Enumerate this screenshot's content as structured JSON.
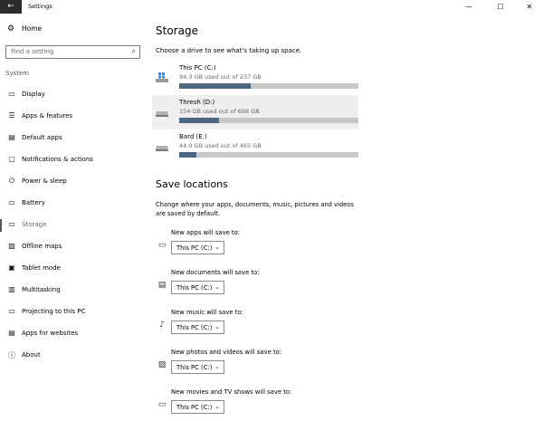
{
  "window": {
    "back_icon": "back-arrow-icon",
    "title": "Settings",
    "minimize": "—",
    "maximize": "☐",
    "close": "✕"
  },
  "sidebar": {
    "home": {
      "label": "Home",
      "icon": "gear-icon"
    },
    "search_placeholder": "Find a setting",
    "section": "System",
    "items": [
      {
        "label": "Display",
        "icon": "display-icon",
        "glyph": "▭"
      },
      {
        "label": "Apps & features",
        "icon": "apps-list-icon",
        "glyph": "☰"
      },
      {
        "label": "Default apps",
        "icon": "default-apps-icon",
        "glyph": "▤"
      },
      {
        "label": "Notifications & actions",
        "icon": "notifications-icon",
        "glyph": "▢"
      },
      {
        "label": "Power & sleep",
        "icon": "power-icon",
        "glyph": "⏻"
      },
      {
        "label": "Battery",
        "icon": "battery-icon",
        "glyph": "▭"
      },
      {
        "label": "Storage",
        "icon": "storage-icon",
        "glyph": "▭",
        "active": true
      },
      {
        "label": "Offline maps",
        "icon": "map-icon",
        "glyph": "▨"
      },
      {
        "label": "Tablet mode",
        "icon": "tablet-icon",
        "glyph": "▣"
      },
      {
        "label": "Multitasking",
        "icon": "multitasking-icon",
        "glyph": "▥"
      },
      {
        "label": "Projecting to this PC",
        "icon": "projecting-icon",
        "glyph": "▭"
      },
      {
        "label": "Apps for websites",
        "icon": "apps-websites-icon",
        "glyph": "▤"
      },
      {
        "label": "About",
        "icon": "info-icon",
        "glyph": "ⓘ"
      }
    ]
  },
  "main": {
    "title": "Storage",
    "subtitle": "Choose a drive to see what's taking up space.",
    "drives": [
      {
        "name": "This PC (C:)",
        "usage": "94.3 GB used out of 237 GB",
        "used_fraction": 0.398,
        "icon": "windows-drive-icon",
        "highlighted": false
      },
      {
        "name": "Thresh (D:)",
        "usage": "154 GB used out of 698 GB",
        "used_fraction": 0.221,
        "icon": "hard-drive-icon",
        "highlighted": true
      },
      {
        "name": "Bard (E:)",
        "usage": "44.0 GB used out of 465 GB",
        "used_fraction": 0.095,
        "icon": "hard-drive-icon",
        "highlighted": false
      }
    ],
    "save_title": "Save locations",
    "save_desc": "Change where your apps, documents, music, pictures and videos are saved by default.",
    "locations": [
      {
        "label": "New apps will save to:",
        "value": "This PC (C:)",
        "icon": "monitor-icon"
      },
      {
        "label": "New documents will save to:",
        "value": "This PC (C:)",
        "icon": "folder-documents-icon"
      },
      {
        "label": "New music will save to:",
        "value": "This PC (C:)",
        "icon": "music-note-icon"
      },
      {
        "label": "New photos and videos will save to:",
        "value": "This PC (C:)",
        "icon": "photo-icon"
      },
      {
        "label": "New movies and TV shows will save to:",
        "value": "This PC (C:)",
        "icon": "video-camera-icon"
      }
    ]
  },
  "colors": {
    "accent_bar": "#4e6682",
    "bar_track": "#c8c8c8",
    "highlight_row": "#efefef"
  }
}
